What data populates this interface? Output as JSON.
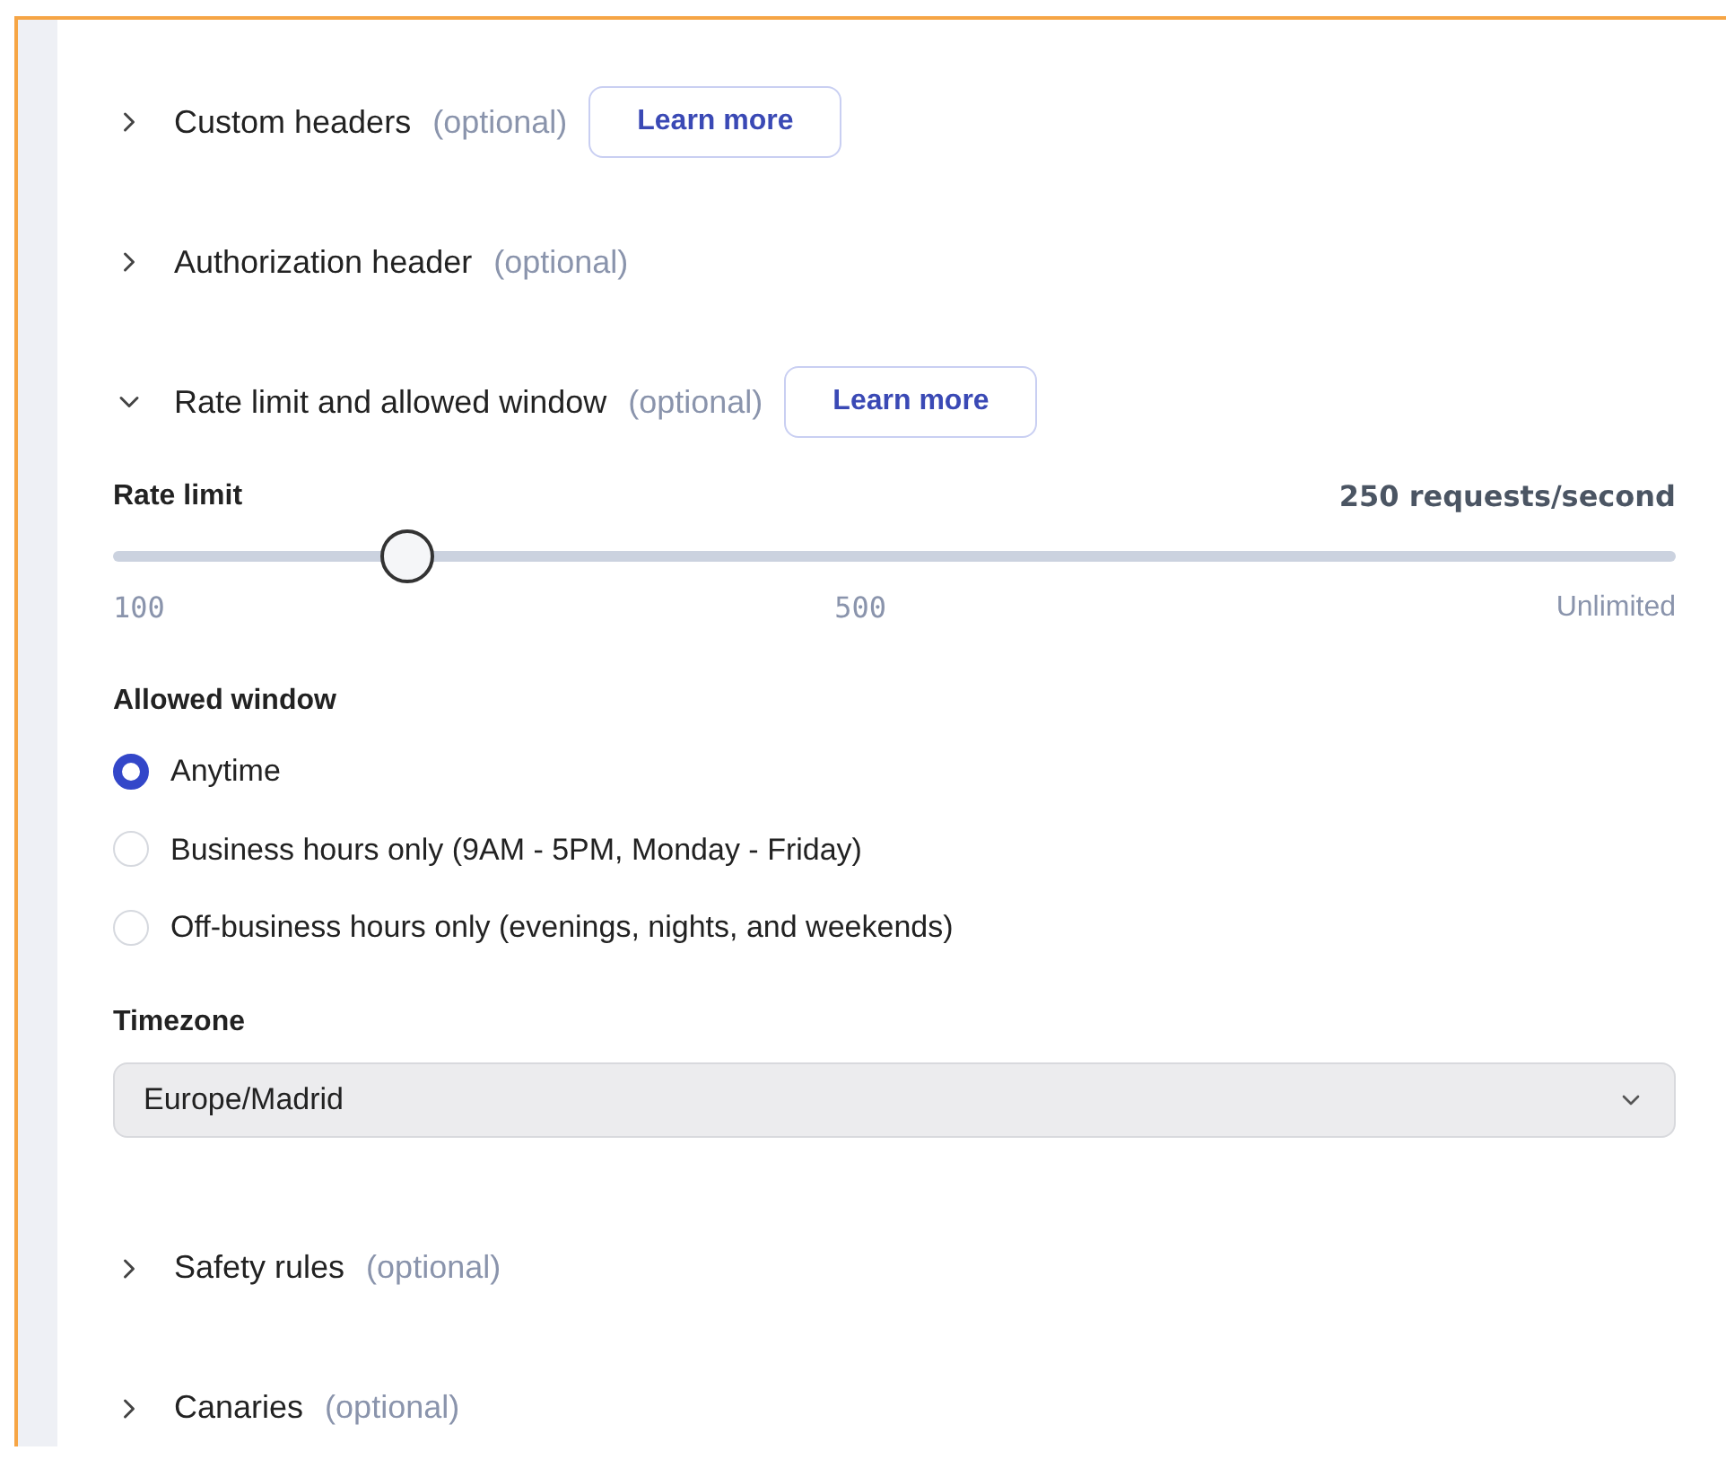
{
  "sections": [
    {
      "title": "Custom headers",
      "note": "(optional)",
      "button": "Learn more",
      "expanded": false
    },
    {
      "title": "Authorization header",
      "note": "(optional)",
      "expanded": false
    },
    {
      "title": "Rate limit and allowed window",
      "note": "(optional)",
      "button": "Learn more",
      "expanded": true,
      "body": {
        "rate_limit": {
          "label": "Rate limit",
          "reading": "250 requests/second",
          "level": 0.188,
          "ticks": [
            "100",
            "500",
            "Unlimited"
          ]
        },
        "allowed_window": {
          "label": "Allowed window",
          "options": [
            {
              "label": "Anytime",
              "selected": true
            },
            {
              "label": "Business hours only (9AM - 5PM, Monday - Friday)",
              "selected": false
            },
            {
              "label": "Off-business hours only (evenings, nights, and weekends)",
              "selected": false
            }
          ]
        },
        "timezone": {
          "label": "Timezone",
          "value": "Europe/Madrid"
        }
      }
    },
    {
      "title": "Safety rules",
      "note": "(optional)",
      "expanded": false
    },
    {
      "title": "Canaries",
      "note": "(optional)",
      "expanded": false
    }
  ]
}
